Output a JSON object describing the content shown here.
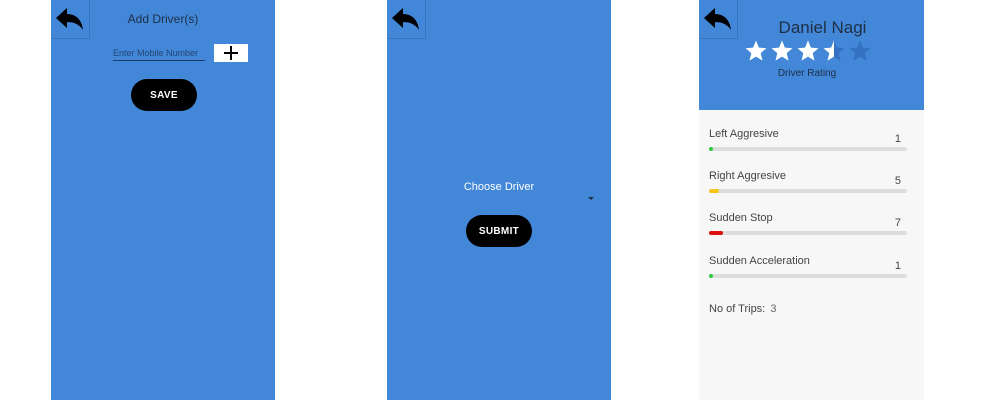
{
  "screen1": {
    "title": "Add Driver(s)",
    "mobile_placeholder": "Enter Mobile Number",
    "save_label": "SAVE"
  },
  "screen2": {
    "choose_label": "Choose Driver",
    "submit_label": "SUBMIT"
  },
  "screen3": {
    "driver_name": "Daniel Nagi",
    "rating": 3.5,
    "rating_max": 5,
    "rating_label": "Driver Rating",
    "metrics": [
      {
        "label": "Left Aggresive",
        "value": "1",
        "fill_fraction": 0.02,
        "color": "#2ecc40"
      },
      {
        "label": "Right Aggresive",
        "value": "5",
        "fill_fraction": 0.05,
        "color": "#f5c518"
      },
      {
        "label": "Sudden Stop",
        "value": "7",
        "fill_fraction": 0.07,
        "color": "#e01010"
      },
      {
        "label": "Sudden Acceleration",
        "value": "1",
        "fill_fraction": 0.02,
        "color": "#2ecc40"
      }
    ],
    "trips_label": "No of Trips:",
    "trips_value": "3"
  },
  "colors": {
    "primary": "#4287d8",
    "button": "#000000",
    "panel_bg": "#f7f7f7"
  }
}
